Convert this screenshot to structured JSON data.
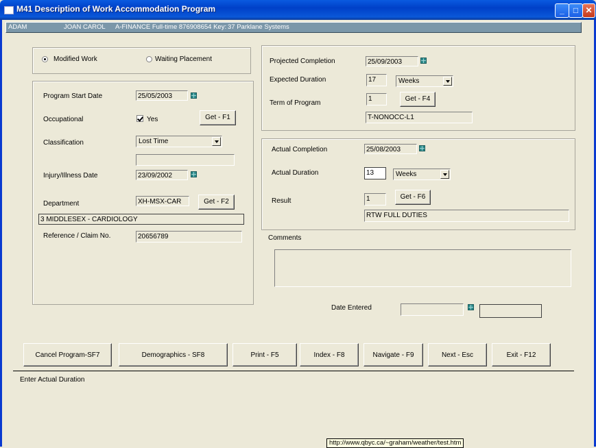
{
  "window": {
    "title": "M41 Description of Work Accommodation Program"
  },
  "infobar": {
    "last_name": "ADAM",
    "first_names": "JOAN CAROL",
    "details": "A-FINANCE  Full-time 876908654 Key:",
    "company": "37 Parklane Systems"
  },
  "mode": {
    "modified_work_label": "Modified Work",
    "waiting_placement_label": "Waiting Placement",
    "selected": "Modified Work"
  },
  "program": {
    "start_date_label": "Program Start Date",
    "start_date": "25/05/2003",
    "occupational_label": "Occupational",
    "occupational_value": "Yes",
    "get_f1": "Get - F1",
    "classification_label": "Classification",
    "classification": "Lost Time",
    "classification_extra": "",
    "injury_date_label": "Injury/Illness Date",
    "injury_date": "23/09/2002",
    "department_label": "Department",
    "department_code": "XH-MSX-CAR",
    "get_f2": "Get - F2",
    "department_name": "3 MIDDLESEX - CARDIOLOGY",
    "claim_label": "Reference / Claim No.",
    "claim_no": "20656789"
  },
  "projected": {
    "completion_label": "Projected Completion",
    "completion": "25/09/2003",
    "duration_label": "Expected Duration",
    "duration": "17",
    "duration_unit": "Weeks",
    "term_label": "Term of Program",
    "term": "1",
    "get_f4": "Get - F4",
    "term_code": "T-NONOCC-L1"
  },
  "actual": {
    "completion_label": "Actual Completion",
    "completion": "25/08/2003",
    "duration_label": "Actual Duration",
    "duration": "13",
    "duration_unit": "Weeks",
    "result_label": "Result",
    "result": "1",
    "get_f6": "Get - F6",
    "result_text": "RTW FULL DUTIES"
  },
  "comments": {
    "label": "Comments",
    "text": ""
  },
  "date_entered": {
    "label": "Date Entered",
    "date": "",
    "extra": ""
  },
  "buttons": {
    "cancel": "Cancel Program-SF7",
    "demographics": "Demographics - SF8",
    "print": "Print - F5",
    "index": "Index - F8",
    "navigate": "Navigate - F9",
    "next": "Next - Esc",
    "exit": "Exit - F12"
  },
  "status_text": "Enter Actual Duration",
  "tooltip_url": "http://www.qbyc.ca/~graham/weather/test.htm",
  "colors": {
    "titlebar": "#0040c8",
    "infobar": "#7b97a9",
    "background": "#ece9d8",
    "calendar_icon": "#2e8b8b"
  }
}
